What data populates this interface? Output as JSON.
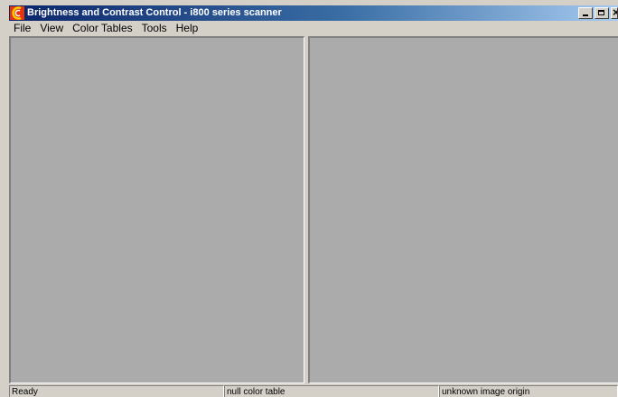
{
  "window": {
    "title": "Brightness and Contrast Control - i800 series scanner",
    "icon": "app-icon",
    "controls": [
      "minimize-icon",
      "maximize-icon",
      "close-icon"
    ]
  },
  "menubar": {
    "items": [
      {
        "label": "File"
      },
      {
        "label": "View"
      },
      {
        "label": "Color Tables"
      },
      {
        "label": "Tools"
      },
      {
        "label": "Help"
      }
    ]
  },
  "panes": {
    "left": {
      "color": "#ababab"
    },
    "right": {
      "color": "#ababab"
    }
  },
  "statusbar": {
    "status": "Ready",
    "color_table": "null color table",
    "image_origin": "unknown image origin"
  },
  "colors": {
    "titlebar_start": "#0a246a",
    "titlebar_end": "#a6caf0",
    "chrome": "#d4d0c8",
    "pane": "#ababab"
  }
}
